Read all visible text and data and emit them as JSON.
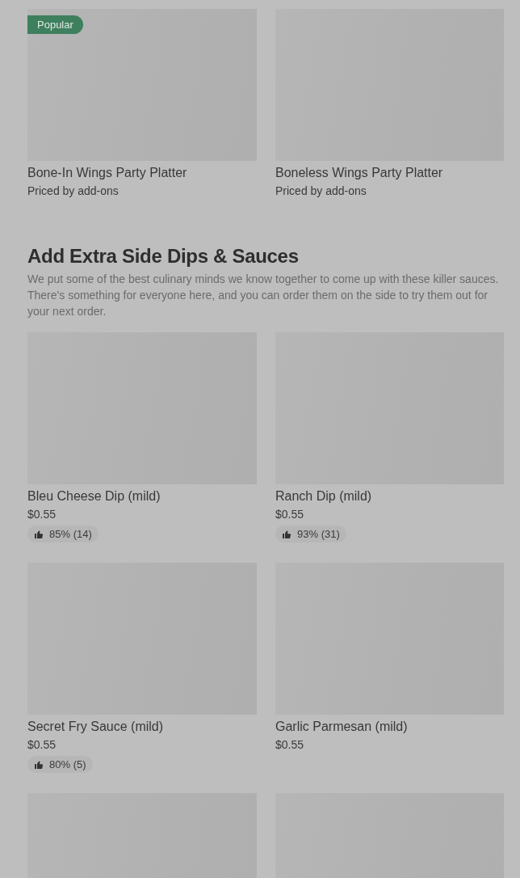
{
  "top_items": [
    {
      "kind": "full",
      "badge": "Popular",
      "name": "Bone-In Wings Party Platter",
      "price": "Priced by add-ons"
    },
    {
      "kind": "full",
      "name": "Boneless Wings Party Platter",
      "price": "Priced by add-ons"
    }
  ],
  "section": {
    "title": "Add Extra Side Dips & Sauces",
    "description": "We put some of the best culinary minds we know together to come up with these killer sauces. There's something for everyone here, and you can order them on the side to try them out for your next order.",
    "items": [
      {
        "kind": "full",
        "name": "Bleu Cheese Dip (mild)",
        "price": "$0.55",
        "rating": "85% (14)"
      },
      {
        "kind": "full",
        "name": "Ranch Dip (mild)",
        "price": "$0.55",
        "rating": "93% (31)"
      },
      {
        "kind": "full",
        "name": "Secret Fry Sauce (mild)",
        "price": "$0.55",
        "rating": "80% (5)"
      },
      {
        "kind": "full",
        "name": "Garlic Parmesan (mild)",
        "price": "$0.55"
      },
      {
        "kind": "cut"
      },
      {
        "kind": "cut"
      }
    ]
  }
}
